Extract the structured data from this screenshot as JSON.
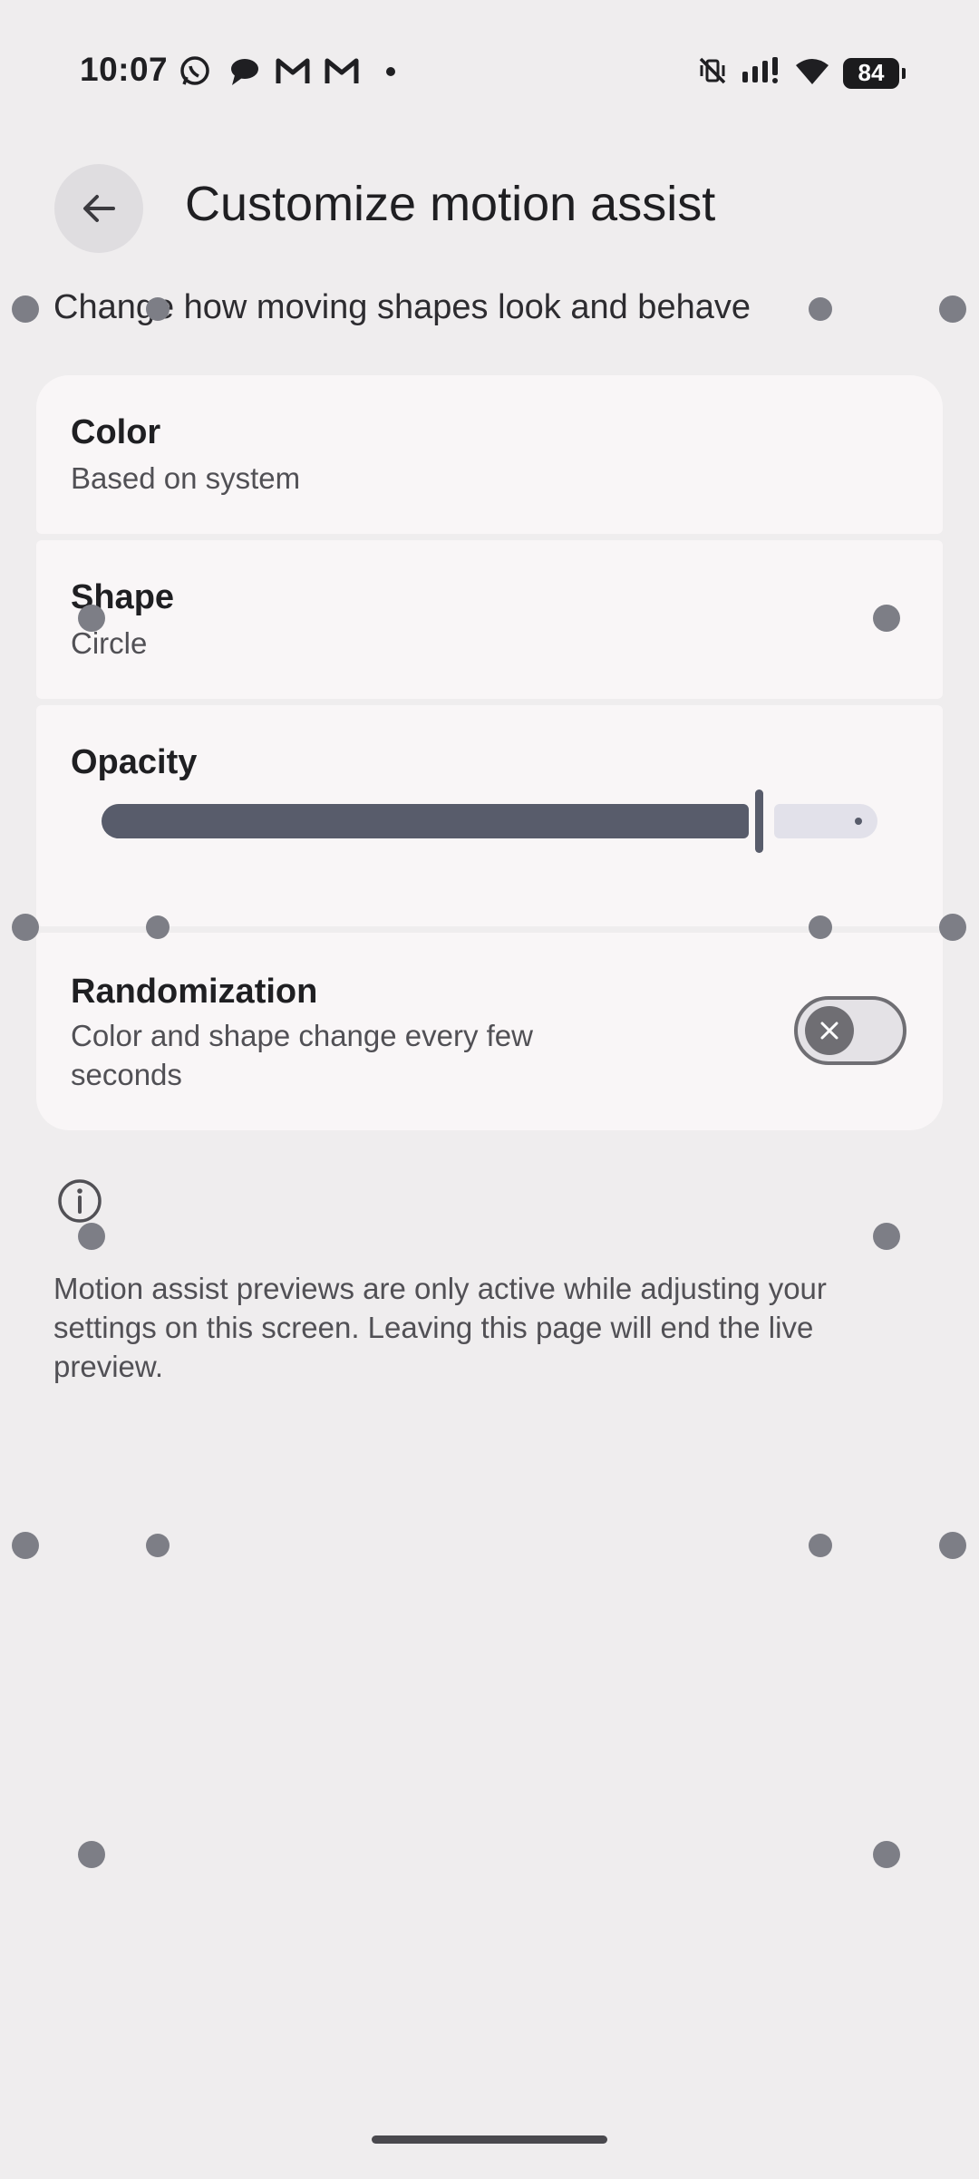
{
  "status_bar": {
    "time": "10:07",
    "battery": "84",
    "left_icons": [
      "whatsapp-icon",
      "chat-bubble-icon",
      "gmail-icon",
      "gmail-icon",
      "more-notifications-dot"
    ],
    "right_icons": [
      "vibrate-off-icon",
      "signal-icon",
      "wifi-icon",
      "battery-icon"
    ]
  },
  "header": {
    "title": "Customize motion assist",
    "subtitle": "Change how moving shapes look and behave"
  },
  "settings": {
    "color": {
      "title": "Color",
      "value": "Based on system"
    },
    "shape": {
      "title": "Shape",
      "value": "Circle"
    },
    "opacity": {
      "title": "Opacity",
      "level": 0.87
    },
    "randomization": {
      "title": "Randomization",
      "description": "Color and shape change every few seconds",
      "enabled": false
    }
  },
  "footer": {
    "info_text": "Motion assist previews are only active while adjusting your settings on this screen. Leaving this page will end the live preview."
  },
  "colors": {
    "background": "#efedee",
    "card": "#f9f6f7",
    "accent": "#585c6b",
    "motion_dot": "#7d7e86"
  }
}
